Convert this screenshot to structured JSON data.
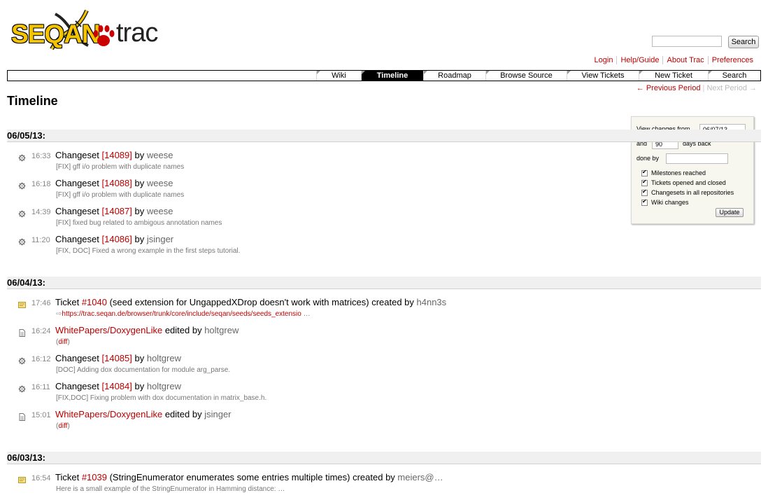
{
  "logo": {
    "left_text": "SEQAN",
    "right_text": "trac"
  },
  "search": {
    "button_label": "Search",
    "placeholder": ""
  },
  "metanav": [
    "Login",
    "Help/Guide",
    "About Trac",
    "Preferences"
  ],
  "mainnav": [
    "Wiki",
    "Timeline",
    "Roadmap",
    "Browse Source",
    "View Tickets",
    "New Ticket",
    "Search"
  ],
  "mainnav_active": "Timeline",
  "ctxtnav": {
    "prev": "← Previous Period",
    "next": "Next Period →"
  },
  "page_title": "Timeline",
  "prefs": {
    "from_label": "View changes from",
    "from_value": "06/07/13",
    "and_label": "and",
    "days_value": "90",
    "days_label": "days back",
    "done_by_label": "done by",
    "done_by_value": "",
    "filters": [
      "Milestones reached",
      "Tickets opened and closed",
      "Changesets in all repositories",
      "Wiki changes"
    ],
    "update_label": "Update"
  },
  "days": [
    {
      "label": "06/05/13:",
      "events": [
        {
          "kind": "changeset",
          "time": "16:33",
          "prefix": "Changeset ",
          "ref": "[14089]",
          "mid": " by ",
          "author": "weese",
          "desc": "[FIX] gff i/o problem with duplicate names"
        },
        {
          "kind": "changeset",
          "time": "16:18",
          "prefix": "Changeset ",
          "ref": "[14088]",
          "mid": " by ",
          "author": "weese",
          "desc": "[FIX] gff i/o problem with duplicate names"
        },
        {
          "kind": "changeset",
          "time": "14:39",
          "prefix": "Changeset ",
          "ref": "[14087]",
          "mid": " by ",
          "author": "weese",
          "desc": "[FIX] fixed bug related to ambigous annotation names"
        },
        {
          "kind": "changeset",
          "time": "11:20",
          "prefix": "Changeset ",
          "ref": "[14086]",
          "mid": " by ",
          "author": "jsinger",
          "desc": "[FIX, DOC] Fixed a wrong example in the first steps tutorial."
        }
      ]
    },
    {
      "label": "06/04/13:",
      "events": [
        {
          "kind": "ticket",
          "time": "17:46",
          "prefix": "Ticket ",
          "ref": "#1040",
          "mid": " (seed extension for UngappedXDrop doesn't work with matrices) created by ",
          "author": "h4nn3s",
          "desc_link": "https://trac.seqan.de/browser/trunk/core/include/seqan/seeds/seeds_extensio",
          "desc_after": " …"
        },
        {
          "kind": "wiki",
          "time": "16:24",
          "prefix": "",
          "ref": "WhitePapers/DoxygenLike",
          "mid": " edited by ",
          "author": "holtgrew",
          "desc_paren_link": "diff"
        },
        {
          "kind": "changeset",
          "time": "16:12",
          "prefix": "Changeset ",
          "ref": "[14085]",
          "mid": " by ",
          "author": "holtgrew",
          "desc": "[DOC] Adding dox documentation for module arg_parse."
        },
        {
          "kind": "changeset",
          "time": "16:11",
          "prefix": "Changeset ",
          "ref": "[14084]",
          "mid": " by ",
          "author": "holtgrew",
          "desc": "[FIX,DOC] Fixing problem with dox documentation in matrix_base.h."
        },
        {
          "kind": "wiki",
          "time": "15:01",
          "prefix": "",
          "ref": "WhitePapers/DoxygenLike",
          "mid": " edited by ",
          "author": "jsinger",
          "desc_paren_link": "diff"
        }
      ]
    },
    {
      "label": "06/03/13:",
      "events": [
        {
          "kind": "ticket",
          "time": "16:54",
          "prefix": "Ticket ",
          "ref": "#1039",
          "mid": " (StringEnumerator enumerates some entries multiple times) created by ",
          "author": "meiers@…",
          "desc": "Here is a small example of the StringEnumerator in Hamming distance: …"
        }
      ]
    }
  ],
  "colors": {
    "link": "#bb0000",
    "day_bg": "#f0f0f0",
    "active_tab": "#000000"
  },
  "icons": {
    "changeset": "gear-icon",
    "ticket": "ticket-icon",
    "wiki": "wiki-page-icon"
  }
}
